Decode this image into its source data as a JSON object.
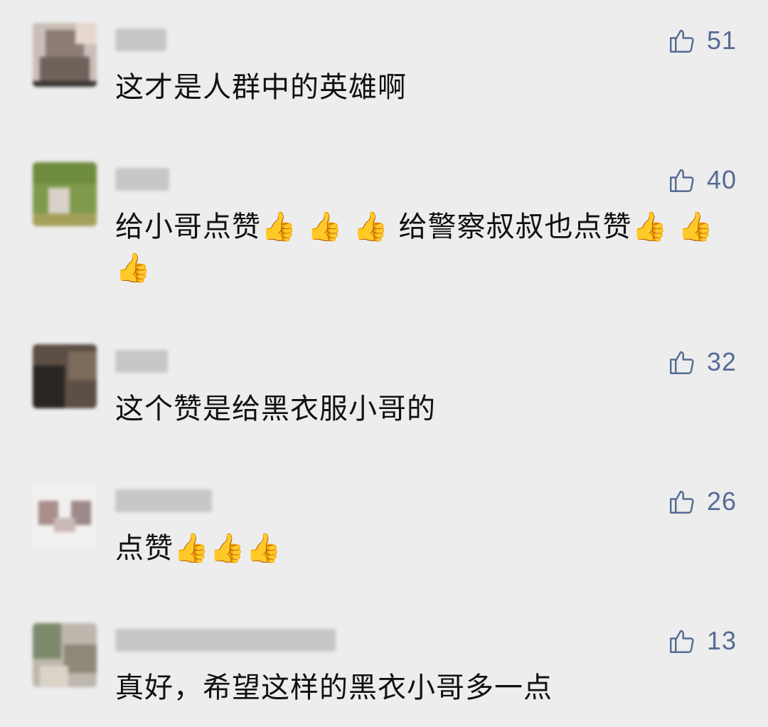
{
  "comments": [
    {
      "text": "这才是人群中的英雄啊",
      "likes": "51"
    },
    {
      "text": "给小哥点赞👍 👍 👍 给警察叔叔也点赞👍 👍 👍",
      "likes": "40"
    },
    {
      "text": "这个赞是给黑衣服小哥的",
      "likes": "32"
    },
    {
      "text": "点赞👍👍👍",
      "likes": "26"
    },
    {
      "text": "真好，希望这样的黑衣小哥多一点",
      "likes": "13"
    }
  ],
  "icons": {
    "like": "thumbs-up-icon"
  },
  "colors": {
    "background": "#ededed",
    "like_count": "#576b95",
    "text": "#111111"
  }
}
